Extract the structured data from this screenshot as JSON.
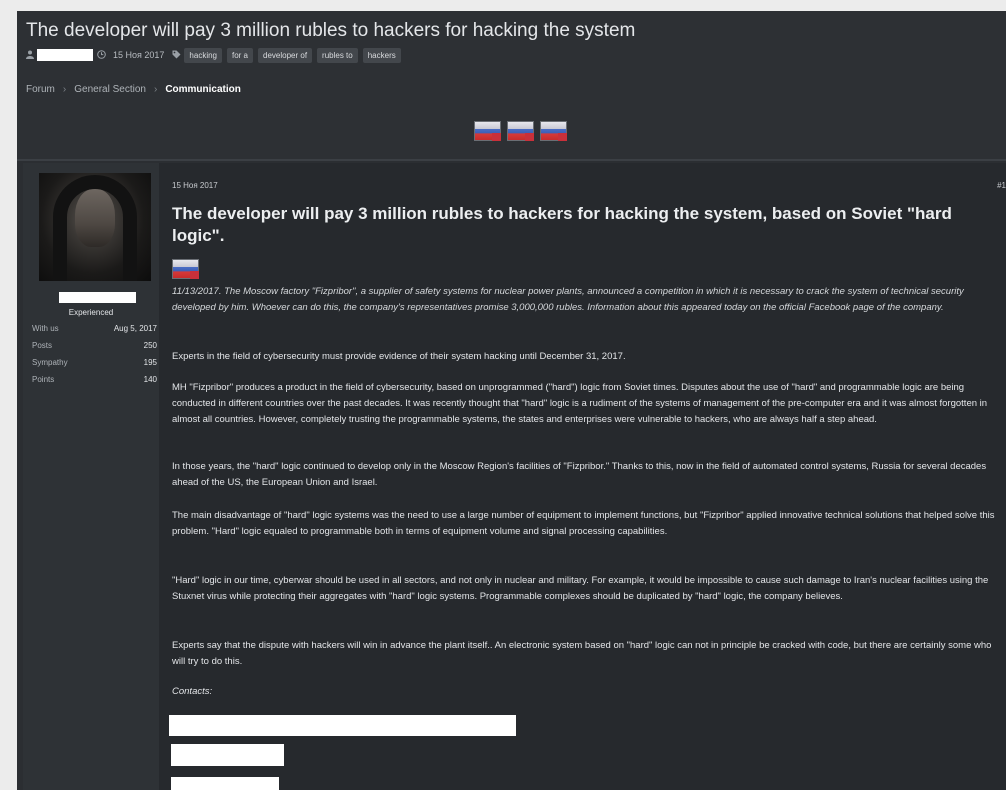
{
  "thread": {
    "title": "The developer will pay 3 million rubles to hackers for hacking the system",
    "date": "15 Ноя 2017",
    "tags": [
      "hacking",
      "for a",
      "developer of",
      "rubles to",
      "hackers"
    ]
  },
  "breadcrumb": [
    "Forum",
    "General Section",
    "Communication"
  ],
  "breadcrumb_separator": "›",
  "user": {
    "title": "Experienced",
    "stats": [
      {
        "label": "With us",
        "value": "Aug 5, 2017"
      },
      {
        "label": "Posts",
        "value": "250"
      },
      {
        "label": "Sympathy",
        "value": "195"
      },
      {
        "label": "Points",
        "value": "140"
      }
    ]
  },
  "post": {
    "date": "15 Ноя 2017",
    "number": "#1",
    "heading": "The developer will pay 3 million rubles to hackers for hacking the system, based on Soviet \"hard logic\".",
    "lead": "11/13/2017. The Moscow factory \"Fizpribor\", a supplier of safety systems for nuclear power plants, announced a competition in which it is necessary to crack the system of technical security developed by him. Whoever can do this, the company's representatives promise 3,000,000 rubles. Information about this appeared today on the official Facebook page of the company.",
    "paragraphs": [
      "Experts in the field of cybersecurity must provide evidence of their system hacking until December 31, 2017.",
      "MH \"Fizpribor\" produces a product in the field of cybersecurity, based on unprogrammed (\"hard\") logic from Soviet times. Disputes about the use of \"hard\" and programmable logic are being conducted in different countries over the past decades. It was recently thought that \"hard\" logic is a rudiment of the systems of management of the pre-computer era and it was almost forgotten in almost all countries. However, completely trusting the programmable systems, the states and enterprises were vulnerable to hackers, who are always half a step ahead.",
      "In those years, the \"hard\" logic continued to develop only in the Moscow Region's facilities of \"Fizpribor.\" Thanks to this, now in the field of automated control systems, Russia for several decades ahead of the US, the European Union and Israel.",
      "The main disadvantage of \"hard\" logic systems was the need to use a large number of equipment to implement functions, but \"Fizpribor\" applied innovative technical solutions that helped solve this problem. \"Hard\" logic equaled to programmable both in terms of equipment volume and signal processing capabilities.",
      "\"Hard\" logic in our time, cyberwar should be used in all sectors, and not only in nuclear and military. For example, it would be impossible to cause such damage to Iran's nuclear facilities using the Stuxnet virus while protecting their aggregates with \"hard\" logic systems. Programmable complexes should be duplicated by \"hard\" logic, the company believes.",
      "Experts say that the dispute with hackers will win in advance the plant itself.. An electronic system based on \"hard\" logic can not in principle be cracked with code, but there are certainly some who will try to do this."
    ],
    "contacts_label": "Contacts:"
  },
  "icons": {
    "user_icon": "user-icon",
    "clock_icon": "clock-icon",
    "tag_icon": "tag-icon",
    "flag_icon": "flag-icon"
  },
  "colors": {
    "background": "#2b2e32",
    "sidebar": "#2e3236",
    "text": "#e3e5e8",
    "redaction": "#ffffff"
  }
}
